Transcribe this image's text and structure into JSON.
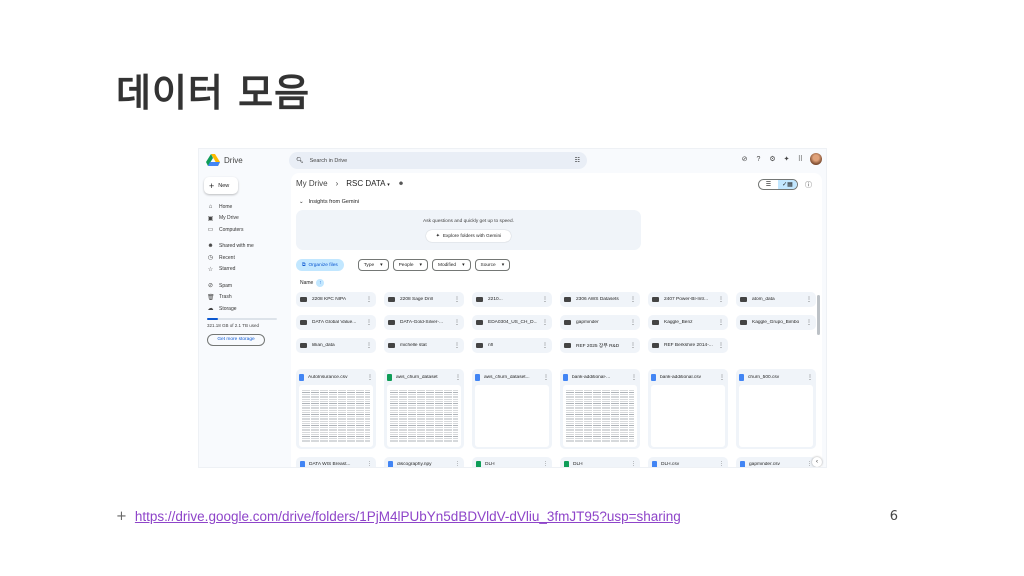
{
  "slide": {
    "title": "데이터 모음",
    "bullet": "+",
    "link": "https://drive.google.com/drive/folders/1PjM4lPUbYn5dBDVldV-dVliu_3fmJT95?usp=sharing",
    "page_number": "6"
  },
  "drive": {
    "app_name": "Drive",
    "search_placeholder": "Search in Drive",
    "new_label": "New",
    "nav": {
      "home": "Home",
      "my_drive": "My Drive",
      "computers": "Computers",
      "shared": "Shared with me",
      "recent": "Recent",
      "starred": "Starred",
      "spam": "Spam",
      "trash": "Trash",
      "storage": "Storage"
    },
    "storage_text": "321.18 GB of 2.1 TB used",
    "storage_fraction": 0.15,
    "get_storage": "Get more storage",
    "breadcrumb": {
      "root": "My Drive",
      "sep": "›",
      "current": "RSC DATA"
    },
    "insights_title": "Insights from Gemini",
    "insights_text": "Ask questions and quickly get up to speed.",
    "explore_label": "Explore folders with Gemini",
    "organize_label": "Organize files",
    "filters": [
      "Type",
      "People",
      "Modified",
      "Source"
    ],
    "sort_label": "Name",
    "folders": [
      "2208 KPC NIPA",
      "2208 Sage Drill",
      "2210...",
      "2306 AWS Datasets",
      "2407 Power-BI-Intr...",
      "atom_data",
      "DATA Global Value...",
      "DATA-Gold-Silver-...",
      "EDA0304_US_CH_D...",
      "gapminder",
      "Kaggle_Benz",
      "Kaggle_Grupo_Bimbo",
      "lillian_data",
      "michelle stat",
      "nfl",
      "REF 2025 장부 R&D",
      "REF Berkshire 2014-..."
    ],
    "files": [
      {
        "name": "AutoInsurance.csv",
        "color": "#4285f4"
      },
      {
        "name": "aws_churn_dataset",
        "color": "#0f9d58"
      },
      {
        "name": "aws_churn_dataset...",
        "color": "#4285f4"
      },
      {
        "name": "bank-additional-...",
        "color": "#4285f4"
      },
      {
        "name": "bank-additional.csv",
        "color": "#4285f4"
      },
      {
        "name": "churn_500.csv",
        "color": "#4285f4"
      }
    ],
    "files_row2": [
      {
        "name": "DATA WIS Breast...",
        "color": "#4285f4"
      },
      {
        "name": "discography.npy",
        "color": "#4285f4"
      },
      {
        "name": "DLH",
        "color": "#0f9d58"
      },
      {
        "name": "DLH",
        "color": "#0f9d58"
      },
      {
        "name": "DLH.csv",
        "color": "#4285f4"
      },
      {
        "name": "gapminder.csv",
        "color": "#4285f4"
      }
    ]
  }
}
